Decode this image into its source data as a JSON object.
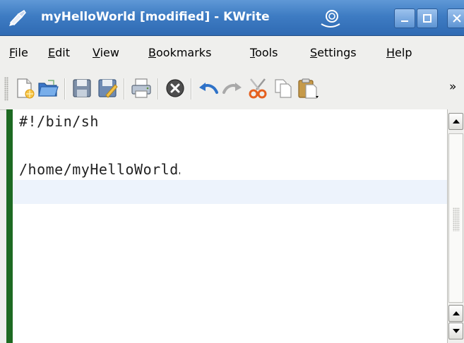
{
  "window": {
    "title": "myHelloWorld [modified] - KWrite"
  },
  "menubar": {
    "items": [
      "File",
      "Edit",
      "View",
      "Bookmarks",
      "Tools",
      "Settings",
      "Help"
    ]
  },
  "toolbar": {
    "icons": [
      "new-document-icon",
      "open-folder-icon",
      "save-icon",
      "save-as-icon",
      "print-icon",
      "close-document-icon",
      "undo-icon",
      "redo-icon",
      "cut-icon",
      "copy-icon",
      "paste-icon"
    ],
    "overflow_label": "»"
  },
  "editor": {
    "lines": [
      "#!/bin/sh",
      "",
      "/home/myHelloWorld",
      ""
    ],
    "background_color": "#ffffff",
    "current_line_color": "#edf3fc"
  },
  "colors": {
    "titlebar": "#3e7cc3",
    "editor_border": "#1d6a22"
  }
}
